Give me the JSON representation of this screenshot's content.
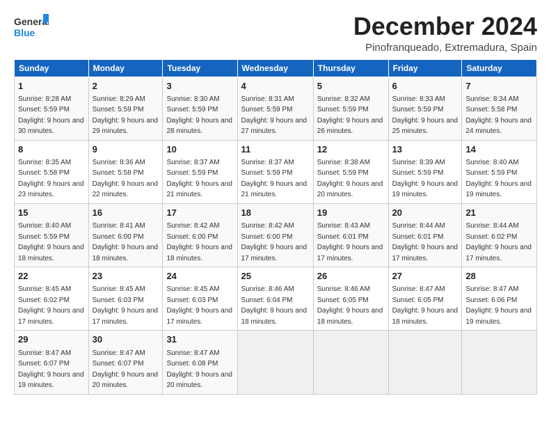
{
  "header": {
    "logo_general": "General",
    "logo_blue": "Blue",
    "title": "December 2024",
    "subtitle": "Pinofranqueado, Extremadura, Spain"
  },
  "calendar": {
    "days_of_week": [
      "Sunday",
      "Monday",
      "Tuesday",
      "Wednesday",
      "Thursday",
      "Friday",
      "Saturday"
    ],
    "weeks": [
      [
        {
          "day": "1",
          "sunrise": "Sunrise: 8:28 AM",
          "sunset": "Sunset: 5:59 PM",
          "daylight": "Daylight: 9 hours and 30 minutes."
        },
        {
          "day": "2",
          "sunrise": "Sunrise: 8:29 AM",
          "sunset": "Sunset: 5:59 PM",
          "daylight": "Daylight: 9 hours and 29 minutes."
        },
        {
          "day": "3",
          "sunrise": "Sunrise: 8:30 AM",
          "sunset": "Sunset: 5:59 PM",
          "daylight": "Daylight: 9 hours and 28 minutes."
        },
        {
          "day": "4",
          "sunrise": "Sunrise: 8:31 AM",
          "sunset": "Sunset: 5:59 PM",
          "daylight": "Daylight: 9 hours and 27 minutes."
        },
        {
          "day": "5",
          "sunrise": "Sunrise: 8:32 AM",
          "sunset": "Sunset: 5:59 PM",
          "daylight": "Daylight: 9 hours and 26 minutes."
        },
        {
          "day": "6",
          "sunrise": "Sunrise: 8:33 AM",
          "sunset": "Sunset: 5:59 PM",
          "daylight": "Daylight: 9 hours and 25 minutes."
        },
        {
          "day": "7",
          "sunrise": "Sunrise: 8:34 AM",
          "sunset": "Sunset: 5:58 PM",
          "daylight": "Daylight: 9 hours and 24 minutes."
        }
      ],
      [
        {
          "day": "8",
          "sunrise": "Sunrise: 8:35 AM",
          "sunset": "Sunset: 5:58 PM",
          "daylight": "Daylight: 9 hours and 23 minutes."
        },
        {
          "day": "9",
          "sunrise": "Sunrise: 8:36 AM",
          "sunset": "Sunset: 5:58 PM",
          "daylight": "Daylight: 9 hours and 22 minutes."
        },
        {
          "day": "10",
          "sunrise": "Sunrise: 8:37 AM",
          "sunset": "Sunset: 5:59 PM",
          "daylight": "Daylight: 9 hours and 21 minutes."
        },
        {
          "day": "11",
          "sunrise": "Sunrise: 8:37 AM",
          "sunset": "Sunset: 5:59 PM",
          "daylight": "Daylight: 9 hours and 21 minutes."
        },
        {
          "day": "12",
          "sunrise": "Sunrise: 8:38 AM",
          "sunset": "Sunset: 5:59 PM",
          "daylight": "Daylight: 9 hours and 20 minutes."
        },
        {
          "day": "13",
          "sunrise": "Sunrise: 8:39 AM",
          "sunset": "Sunset: 5:59 PM",
          "daylight": "Daylight: 9 hours and 19 minutes."
        },
        {
          "day": "14",
          "sunrise": "Sunrise: 8:40 AM",
          "sunset": "Sunset: 5:59 PM",
          "daylight": "Daylight: 9 hours and 19 minutes."
        }
      ],
      [
        {
          "day": "15",
          "sunrise": "Sunrise: 8:40 AM",
          "sunset": "Sunset: 5:59 PM",
          "daylight": "Daylight: 9 hours and 18 minutes."
        },
        {
          "day": "16",
          "sunrise": "Sunrise: 8:41 AM",
          "sunset": "Sunset: 6:00 PM",
          "daylight": "Daylight: 9 hours and 18 minutes."
        },
        {
          "day": "17",
          "sunrise": "Sunrise: 8:42 AM",
          "sunset": "Sunset: 6:00 PM",
          "daylight": "Daylight: 9 hours and 18 minutes."
        },
        {
          "day": "18",
          "sunrise": "Sunrise: 8:42 AM",
          "sunset": "Sunset: 6:00 PM",
          "daylight": "Daylight: 9 hours and 17 minutes."
        },
        {
          "day": "19",
          "sunrise": "Sunrise: 8:43 AM",
          "sunset": "Sunset: 6:01 PM",
          "daylight": "Daylight: 9 hours and 17 minutes."
        },
        {
          "day": "20",
          "sunrise": "Sunrise: 8:44 AM",
          "sunset": "Sunset: 6:01 PM",
          "daylight": "Daylight: 9 hours and 17 minutes."
        },
        {
          "day": "21",
          "sunrise": "Sunrise: 8:44 AM",
          "sunset": "Sunset: 6:02 PM",
          "daylight": "Daylight: 9 hours and 17 minutes."
        }
      ],
      [
        {
          "day": "22",
          "sunrise": "Sunrise: 8:45 AM",
          "sunset": "Sunset: 6:02 PM",
          "daylight": "Daylight: 9 hours and 17 minutes."
        },
        {
          "day": "23",
          "sunrise": "Sunrise: 8:45 AM",
          "sunset": "Sunset: 6:03 PM",
          "daylight": "Daylight: 9 hours and 17 minutes."
        },
        {
          "day": "24",
          "sunrise": "Sunrise: 8:45 AM",
          "sunset": "Sunset: 6:03 PM",
          "daylight": "Daylight: 9 hours and 17 minutes."
        },
        {
          "day": "25",
          "sunrise": "Sunrise: 8:46 AM",
          "sunset": "Sunset: 6:04 PM",
          "daylight": "Daylight: 9 hours and 18 minutes."
        },
        {
          "day": "26",
          "sunrise": "Sunrise: 8:46 AM",
          "sunset": "Sunset: 6:05 PM",
          "daylight": "Daylight: 9 hours and 18 minutes."
        },
        {
          "day": "27",
          "sunrise": "Sunrise: 8:47 AM",
          "sunset": "Sunset: 6:05 PM",
          "daylight": "Daylight: 9 hours and 18 minutes."
        },
        {
          "day": "28",
          "sunrise": "Sunrise: 8:47 AM",
          "sunset": "Sunset: 6:06 PM",
          "daylight": "Daylight: 9 hours and 19 minutes."
        }
      ],
      [
        {
          "day": "29",
          "sunrise": "Sunrise: 8:47 AM",
          "sunset": "Sunset: 6:07 PM",
          "daylight": "Daylight: 9 hours and 19 minutes."
        },
        {
          "day": "30",
          "sunrise": "Sunrise: 8:47 AM",
          "sunset": "Sunset: 6:07 PM",
          "daylight": "Daylight: 9 hours and 20 minutes."
        },
        {
          "day": "31",
          "sunrise": "Sunrise: 8:47 AM",
          "sunset": "Sunset: 6:08 PM",
          "daylight": "Daylight: 9 hours and 20 minutes."
        },
        null,
        null,
        null,
        null
      ]
    ]
  }
}
